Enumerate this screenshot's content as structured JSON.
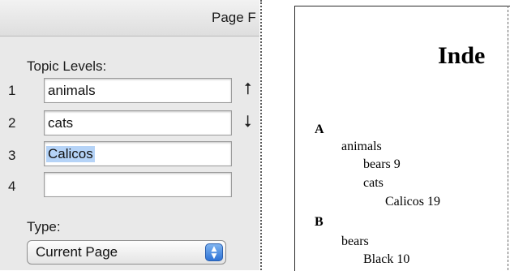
{
  "dialog": {
    "title": "Page F",
    "topic_levels_label": "Topic Levels:",
    "levels": [
      {
        "number": "1",
        "value": "animals"
      },
      {
        "number": "2",
        "value": "cats"
      },
      {
        "number": "3",
        "value": "Calicos"
      },
      {
        "number": "4",
        "value": ""
      }
    ],
    "type_label": "Type:",
    "type_selected": "Current Page",
    "up_arrow": "⭡",
    "down_arrow": "⭣"
  },
  "document": {
    "title": "Inde",
    "entries": [
      {
        "text": "A",
        "level": 0
      },
      {
        "text": "animals",
        "level": 1
      },
      {
        "text": "bears  9",
        "level": 2
      },
      {
        "text": "cats",
        "level": 2
      },
      {
        "text": "Calicos  19",
        "level": 3
      },
      {
        "text": "B",
        "level": 0
      },
      {
        "text": "bears",
        "level": 1
      },
      {
        "text": "Black  10",
        "level": 2
      }
    ]
  }
}
